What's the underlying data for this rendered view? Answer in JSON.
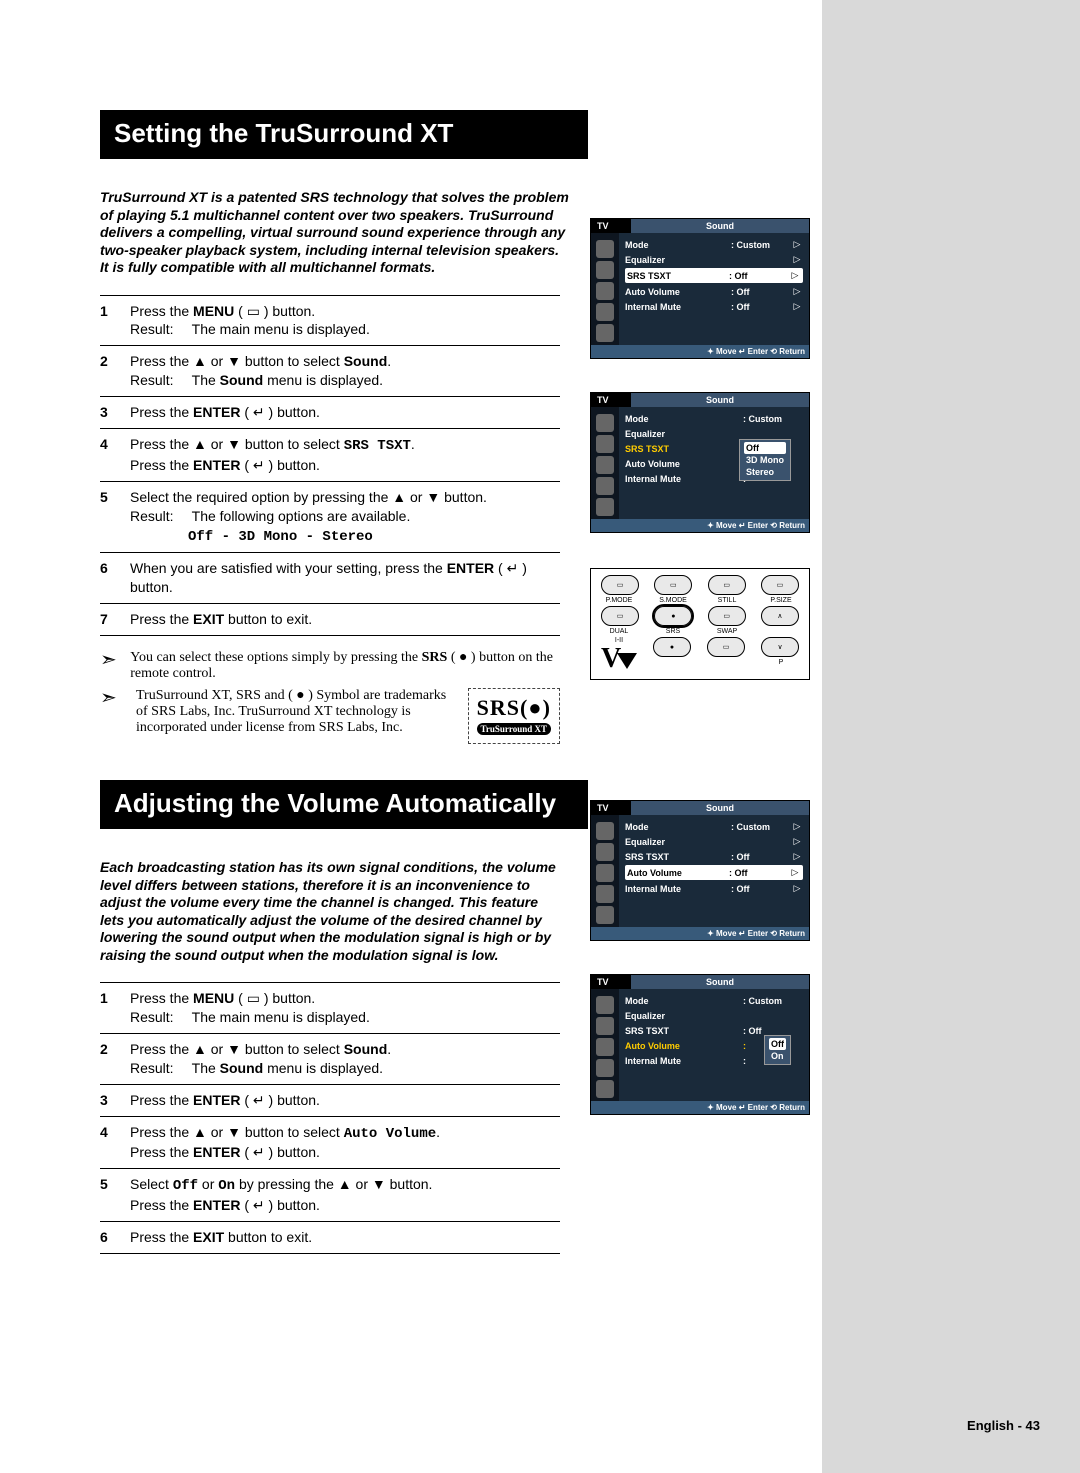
{
  "section1": {
    "title": "Setting the TruSurround XT",
    "intro": "TruSurround XT is a patented SRS technology that solves the problem of playing 5.1 multichannel content over two speakers. TruSurround delivers a compelling, virtual surround sound experience through any two-speaker playback system, including internal television speakers. It is fully compatible with all multichannel formats.",
    "steps": {
      "s1_a": "Press the ",
      "s1_b": "MENU",
      "s1_c": " ( ▭ ) button.",
      "s1_res_lbl": "Result:",
      "s1_res": "The main menu is displayed.",
      "s2_a": "Press the ▲ or ▼ button to select ",
      "s2_b": "Sound",
      "s2_c": ".",
      "s2_res_lbl": "Result:",
      "s2_res_a": "The ",
      "s2_res_b": "Sound",
      "s2_res_c": " menu is displayed.",
      "s3_a": "Press the ",
      "s3_b": "ENTER",
      "s3_c": " ( ↵ ) button.",
      "s4_a": "Press the ▲ or ▼ button to select ",
      "s4_b": "SRS TSXT",
      "s4_c": ".",
      "s4_d": "Press the ",
      "s4_e": "ENTER",
      "s4_f": " ( ↵ ) button.",
      "s5_a": "Select the required option by pressing the ▲ or ▼ button.",
      "s5_res_lbl": "Result:",
      "s5_res": "The following options are available.",
      "s5_opts": "Off - 3D Mono - Stereo",
      "s6_a": "When you are satisfied with your setting, press the ",
      "s6_b": "ENTER",
      "s6_c": " ( ↵ ) button.",
      "s7_a": "Press the ",
      "s7_b": "EXIT",
      "s7_c": " button to exit."
    },
    "notes": {
      "n1_a": "You can select these options simply by pressing the ",
      "n1_b": "SRS",
      "n1_c": " ( ● ) button on the remote control.",
      "n2": "TruSurround XT, SRS and ( ● ) Symbol are trademarks of SRS Labs, Inc. TruSurround XT technology is incorporated under license from SRS Labs, Inc."
    },
    "srs_logo": {
      "big": "SRS(●)",
      "tag": "TruSurround XT"
    }
  },
  "section2": {
    "title": "Adjusting the Volume Automatically",
    "intro": "Each broadcasting station has its own signal conditions, the volume level differs between stations, therefore it is an inconvenience to adjust the volume every time the channel is changed. This feature lets you automatically adjust the volume of the desired channel by lowering the sound output when the modulation signal is high or by raising the sound output when the modulation signal is low.",
    "steps": {
      "s1_a": "Press the ",
      "s1_b": "MENU",
      "s1_c": " ( ▭ ) button.",
      "s1_res_lbl": "Result:",
      "s1_res": "The main menu is displayed.",
      "s2_a": "Press the ▲ or ▼ button to select ",
      "s2_b": "Sound",
      "s2_c": ".",
      "s2_res_lbl": "Result:",
      "s2_res_a": "The ",
      "s2_res_b": "Sound",
      "s2_res_c": " menu is displayed.",
      "s3_a": "Press the ",
      "s3_b": "ENTER",
      "s3_c": " ( ↵ ) button.",
      "s4_a": "Press the ▲ or ▼ button to select ",
      "s4_b": "Auto Volume",
      "s4_c": ".",
      "s4_d": "Press the ",
      "s4_e": "ENTER",
      "s4_f": " ( ↵ ) button.",
      "s5_a": "Select ",
      "s5_b": "Off",
      "s5_c": " or ",
      "s5_d": "On",
      "s5_e": " by pressing the ▲ or ▼ button.",
      "s5_f": "Press the ",
      "s5_g": "ENTER",
      "s5_h": " ( ↵ ) button.",
      "s6_a": "Press the ",
      "s6_b": "EXIT",
      "s6_c": " button to exit."
    }
  },
  "osd": {
    "tv": "TV",
    "title": "Sound",
    "rows": {
      "mode": "Mode",
      "mode_v": ": Custom",
      "eq": "Equalizer",
      "srs": "SRS TSXT",
      "srs_v": ": Off",
      "av": "Auto Volume",
      "av_v": ": Off",
      "im": "Internal Mute",
      "im_v": ": Off"
    },
    "popup_srs": [
      "Off",
      "3D Mono",
      "Stereo"
    ],
    "popup_av": [
      "Off",
      "On"
    ],
    "footer": "✦ Move   ↵ Enter   ⟲ Return"
  },
  "remote": {
    "labels": [
      "P.MODE",
      "S.MODE",
      "STILL",
      "P.SIZE",
      "DUAL",
      "SRS",
      "SWAP"
    ],
    "bottom_labels": [
      "I-II",
      "",
      "",
      "P"
    ]
  },
  "page_num": {
    "label": "English - ",
    "n": "43"
  }
}
